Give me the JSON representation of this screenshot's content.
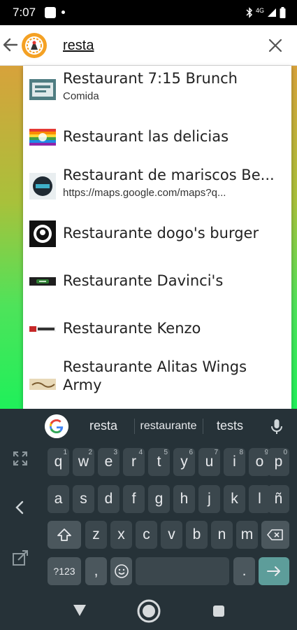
{
  "status_bar": {
    "time": "7:07",
    "network": "4G"
  },
  "search": {
    "query": "resta"
  },
  "suggestions": [
    {
      "title": "Restaurant  7:15 Brunch",
      "subtitle": "Comida"
    },
    {
      "title": "Restaurant las delicias",
      "subtitle": ""
    },
    {
      "title": "Restaurant de mariscos Be...",
      "subtitle": "https://maps.google.com/maps?q..."
    },
    {
      "title": "Restaurante dogo's burger",
      "subtitle": ""
    },
    {
      "title": "Restaurante Davinci's",
      "subtitle": ""
    },
    {
      "title": "Restaurante Kenzo",
      "subtitle": ""
    },
    {
      "title": "Restaurante Alitas Wings Army",
      "subtitle": ""
    }
  ],
  "keyboard": {
    "word_suggestions": [
      "resta",
      "restaurante",
      "tests"
    ],
    "row1": [
      {
        "key": "q",
        "hint": "1"
      },
      {
        "key": "w",
        "hint": "2"
      },
      {
        "key": "e",
        "hint": "3"
      },
      {
        "key": "r",
        "hint": "4"
      },
      {
        "key": "t",
        "hint": "5"
      },
      {
        "key": "y",
        "hint": "6"
      },
      {
        "key": "u",
        "hint": "7"
      },
      {
        "key": "i",
        "hint": "8"
      },
      {
        "key": "o",
        "hint": "9"
      },
      {
        "key": "p",
        "hint": "0"
      }
    ],
    "row2": [
      "a",
      "s",
      "d",
      "f",
      "g",
      "h",
      "j",
      "k",
      "l",
      "ñ"
    ],
    "row3": [
      "z",
      "x",
      "c",
      "v",
      "b",
      "n",
      "m"
    ],
    "symbols_label": "?123",
    "comma_label": ",",
    "period_label": "."
  },
  "colors": {
    "keyboard_bg": "#263238",
    "key_bg": "#3b474d",
    "enter_key": "#5d9d9a",
    "app_gradient_top": "#d7a23b",
    "app_gradient_bottom": "#1ff05a"
  }
}
